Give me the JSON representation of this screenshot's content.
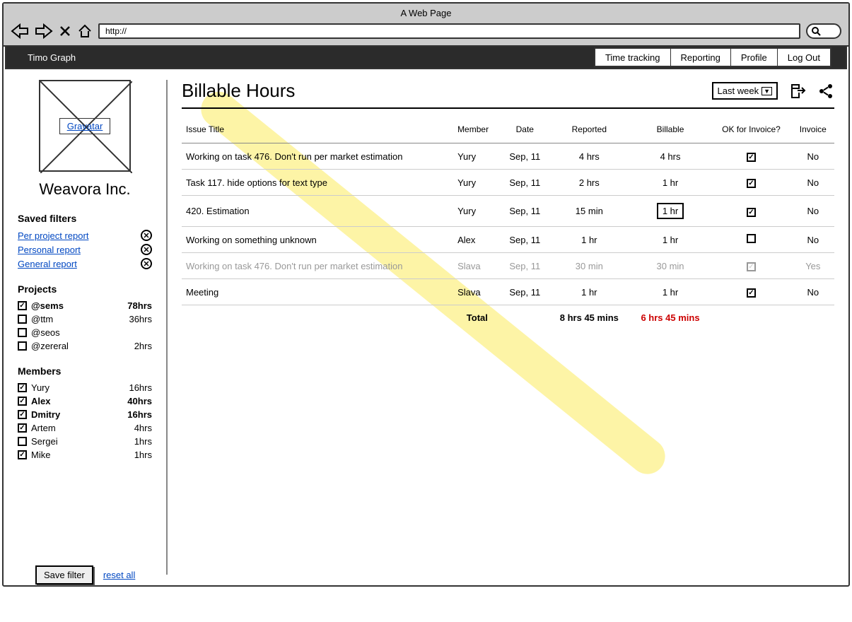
{
  "browser": {
    "title": "A Web Page",
    "url": "http://"
  },
  "app": {
    "title": "Timo Graph",
    "nav": [
      "Time tracking",
      "Reporting",
      "Profile",
      "Log Out"
    ]
  },
  "sidebar": {
    "avatar_label": "Gravatar",
    "company": "Weavora Inc.",
    "saved_filters_heading": "Saved filters",
    "saved_filters": [
      {
        "label": "Per project report"
      },
      {
        "label": "Personal report"
      },
      {
        "label": "General report"
      }
    ],
    "projects_heading": "Projects",
    "projects": [
      {
        "checked": true,
        "name": "@sems",
        "hours": "78hrs",
        "bold": true
      },
      {
        "checked": false,
        "name": "@ttm",
        "hours": "36hrs",
        "bold": false
      },
      {
        "checked": false,
        "name": "@seos",
        "hours": "",
        "bold": false
      },
      {
        "checked": false,
        "name": "@zereral",
        "hours": "2hrs",
        "bold": false
      }
    ],
    "members_heading": "Members",
    "members": [
      {
        "checked": true,
        "name": "Yury",
        "hours": "16hrs",
        "bold": false
      },
      {
        "checked": true,
        "name": "Alex",
        "hours": "40hrs",
        "bold": true
      },
      {
        "checked": true,
        "name": "Dmitry",
        "hours": "16hrs",
        "bold": true
      },
      {
        "checked": true,
        "name": "Artem",
        "hours": "4hrs",
        "bold": false
      },
      {
        "checked": false,
        "name": "Sergei",
        "hours": "1hrs",
        "bold": false
      },
      {
        "checked": true,
        "name": "Mike",
        "hours": "1hrs",
        "bold": false
      }
    ],
    "save_filter_btn": "Save filter",
    "reset_link": "reset all"
  },
  "content": {
    "title": "Billable Hours",
    "period": "Last week",
    "columns": {
      "issue": "Issue Title",
      "member": "Member",
      "date": "Date",
      "reported": "Reported",
      "billable": "Billable",
      "ok": "OK for Invoice?",
      "invoice": "Invoice"
    },
    "rows": [
      {
        "issue": "Working on task 476. Don't run per market estimation",
        "member": "Yury",
        "date": "Sep, 11",
        "reported": "4 hrs",
        "billable": "4 hrs",
        "ok": true,
        "invoice": "No",
        "editable": false,
        "light": false
      },
      {
        "issue": "Task 117. hide options for text type",
        "member": "Yury",
        "date": "Sep, 11",
        "reported": "2 hrs",
        "billable": "1 hr",
        "ok": true,
        "invoice": "No",
        "editable": false,
        "light": false
      },
      {
        "issue": "420. Estimation",
        "member": "Yury",
        "date": "Sep, 11",
        "reported": "15 min",
        "billable": "1 hr",
        "ok": true,
        "invoice": "No",
        "editable": true,
        "light": false
      },
      {
        "issue": "Working on something unknown",
        "member": "Alex",
        "date": "Sep, 11",
        "reported": "1 hr",
        "billable": "1 hr",
        "ok": false,
        "invoice": "No",
        "editable": false,
        "light": false
      },
      {
        "issue": "Working on task 476. Don't run per market estimation",
        "member": "Slava",
        "date": "Sep, 11",
        "reported": "30 min",
        "billable": "30 min",
        "ok": true,
        "invoice": "Yes",
        "editable": false,
        "light": true
      },
      {
        "issue": "Meeting",
        "member": "Slava",
        "date": "Sep, 11",
        "reported": "1 hr",
        "billable": "1 hr",
        "ok": true,
        "invoice": "No",
        "editable": false,
        "light": false
      }
    ],
    "total_label": "Total",
    "total_reported": "8 hrs 45 mins",
    "total_billable": "6 hrs 45 mins"
  }
}
